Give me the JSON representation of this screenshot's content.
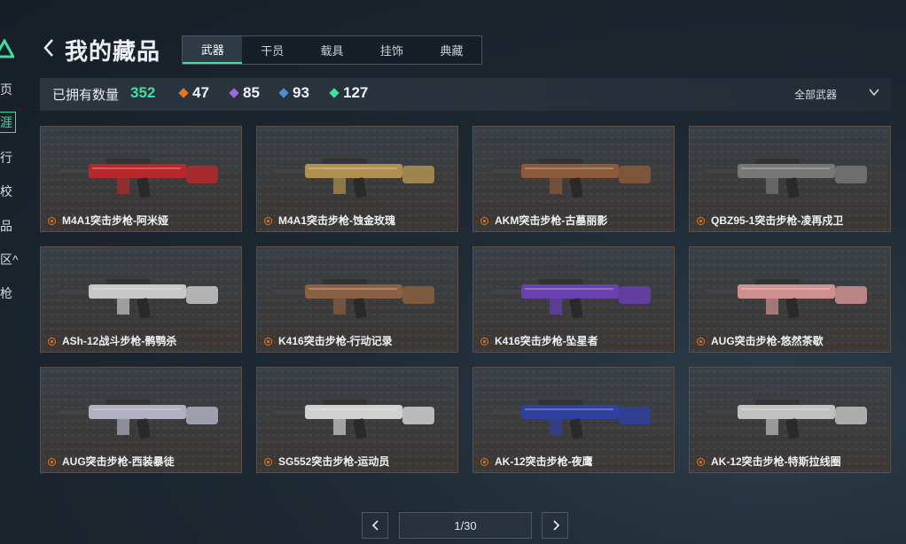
{
  "nav": {
    "items": [
      {
        "label": "页"
      },
      {
        "label": "涯"
      },
      {
        "label": "行"
      },
      {
        "label": "校"
      },
      {
        "label": "品"
      },
      {
        "label": "区^"
      },
      {
        "label": "枪"
      }
    ]
  },
  "header": {
    "title": "我的藏品",
    "tabs": [
      {
        "label": "武器"
      },
      {
        "label": "干员"
      },
      {
        "label": "载具"
      },
      {
        "label": "挂饰"
      },
      {
        "label": "典藏"
      }
    ]
  },
  "stats": {
    "owned_label": "已拥有数量",
    "owned_count": "352",
    "tiers": [
      {
        "value": "47",
        "color": "#e07a2a"
      },
      {
        "value": "85",
        "color": "#9b6ee0"
      },
      {
        "value": "93",
        "color": "#4a90d0"
      },
      {
        "value": "127",
        "color": "#3fe0a0"
      }
    ],
    "filter_label": "全部武器"
  },
  "skins": [
    {
      "name": "M4A1突击步枪-阿米娅",
      "color": "#b8282a"
    },
    {
      "name": "M4A1突击步枪-蚀金玫瑰",
      "color": "#b09050"
    },
    {
      "name": "AKM突击步枪-古墓丽影",
      "color": "#8a5a3a"
    },
    {
      "name": "QBZ95-1突击步枪-凌再戍卫",
      "color": "#777777"
    },
    {
      "name": "ASh-12战斗步枪-鹘鹗杀",
      "color": "#c8c8c8"
    },
    {
      "name": "K416突击步枪-行动记录",
      "color": "#8a6040"
    },
    {
      "name": "K416突击步枪-坠星者",
      "color": "#6a40b0"
    },
    {
      "name": "AUG突击步枪-悠然茶歇",
      "color": "#d09090"
    },
    {
      "name": "AUG突击步枪-西装暴徒",
      "color": "#b0b0c0"
    },
    {
      "name": "SG552突击步枪-运动员",
      "color": "#d0d0d0"
    },
    {
      "name": "AK-12突击步枪-夜鹰",
      "color": "#3040a0"
    },
    {
      "name": "AK-12突击步枪-特斯拉线圈",
      "color": "#c0c0c0"
    }
  ],
  "pager": {
    "info": "1/30"
  }
}
